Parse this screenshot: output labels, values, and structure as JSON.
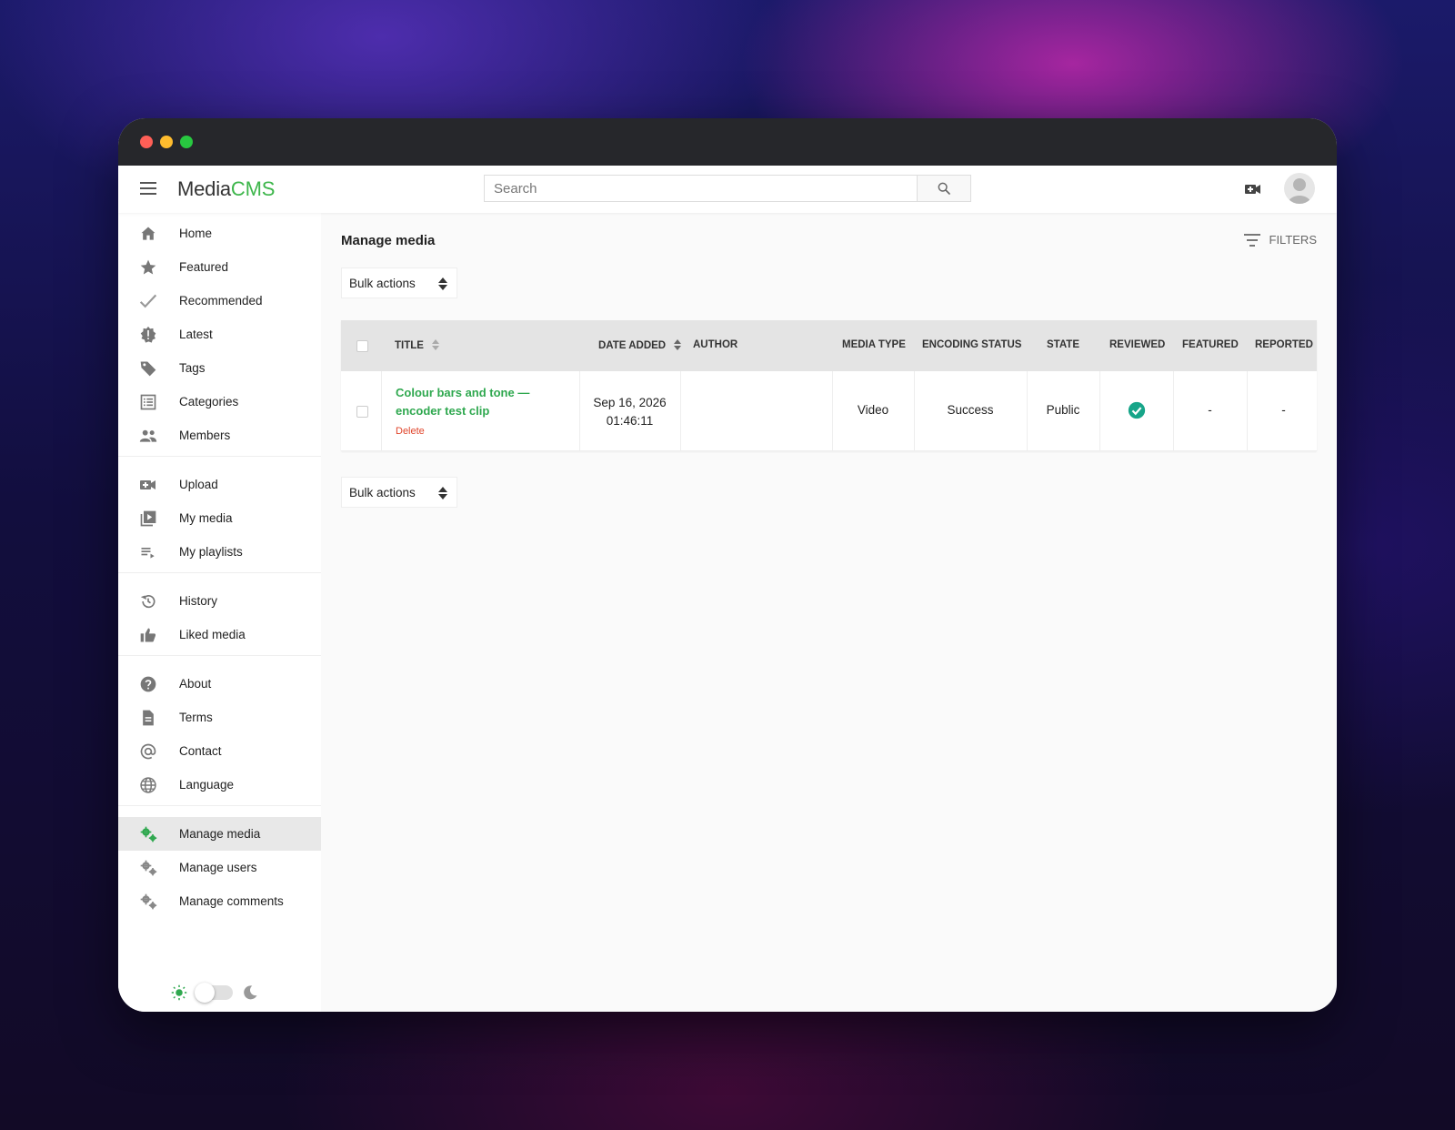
{
  "app": {
    "logo_prefix": "Media",
    "logo_suffix": "CMS"
  },
  "search": {
    "placeholder": "Search"
  },
  "sidebar": {
    "group1": [
      {
        "label": "Home",
        "icon": "home-icon"
      },
      {
        "label": "Featured",
        "icon": "star-icon"
      },
      {
        "label": "Recommended",
        "icon": "check-icon"
      },
      {
        "label": "Latest",
        "icon": "new-badge-icon"
      },
      {
        "label": "Tags",
        "icon": "tag-icon"
      },
      {
        "label": "Categories",
        "icon": "list-icon"
      },
      {
        "label": "Members",
        "icon": "people-icon"
      }
    ],
    "group2": [
      {
        "label": "Upload",
        "icon": "video-add-icon"
      },
      {
        "label": "My media",
        "icon": "video-library-icon"
      },
      {
        "label": "My playlists",
        "icon": "playlist-icon"
      }
    ],
    "group3": [
      {
        "label": "History",
        "icon": "history-icon"
      },
      {
        "label": "Liked media",
        "icon": "thumb-up-icon"
      }
    ],
    "group4": [
      {
        "label": "About",
        "icon": "help-icon"
      },
      {
        "label": "Terms",
        "icon": "document-icon"
      },
      {
        "label": "Contact",
        "icon": "at-icon"
      },
      {
        "label": "Language",
        "icon": "globe-icon"
      }
    ],
    "group5": [
      {
        "label": "Manage media",
        "icon": "gears-icon",
        "active": true
      },
      {
        "label": "Manage users",
        "icon": "gears-icon"
      },
      {
        "label": "Manage comments",
        "icon": "gears-icon"
      }
    ]
  },
  "main": {
    "title": "Manage media",
    "filters_label": "FILTERS",
    "bulk_label": "Bulk actions",
    "table": {
      "headers": {
        "title": "TITLE",
        "date_added": "DATE ADDED",
        "author": "AUTHOR",
        "media_type": "MEDIA TYPE",
        "encoding_status": "ENCODING STATUS",
        "state": "STATE",
        "reviewed": "REVIEWED",
        "featured": "FEATURED",
        "reported": "REPORTED"
      },
      "rows": [
        {
          "title": "Colour bars and tone — encoder test clip",
          "delete_label": "Delete",
          "date": "Sep 16, 2026",
          "time": "01:46:11",
          "author": "",
          "media_type": "Video",
          "encoding_status": "Success",
          "state": "Public",
          "reviewed": "check-circle-icon",
          "featured": "-",
          "reported": "-"
        }
      ]
    }
  },
  "colors": {
    "accent": "#3db64b",
    "link": "#2fa84f",
    "delete": "#e0452b",
    "reviewed": "#17a589"
  }
}
